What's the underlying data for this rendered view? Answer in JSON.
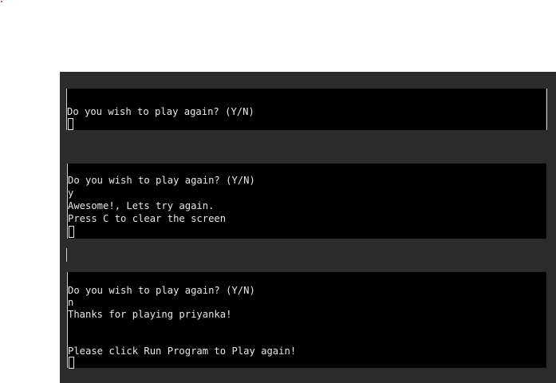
{
  "terminal_1": {
    "lines": [
      "Do you wish to play again? (Y/N)"
    ]
  },
  "terminal_2": {
    "lines": [
      "Do you wish to play again? (Y/N)",
      "y",
      "Awesome!, Lets try again.",
      "Press C to clear the screen"
    ]
  },
  "terminal_3": {
    "lines": [
      "Do you wish to play again? (Y/N)",
      "n",
      "Thanks for playing priyanka!",
      "",
      "Please click Run Program to Play again!"
    ]
  },
  "colors": {
    "frame": "#2b2b2b",
    "terminal_bg": "#000000",
    "terminal_text": "#e6e6e6"
  }
}
